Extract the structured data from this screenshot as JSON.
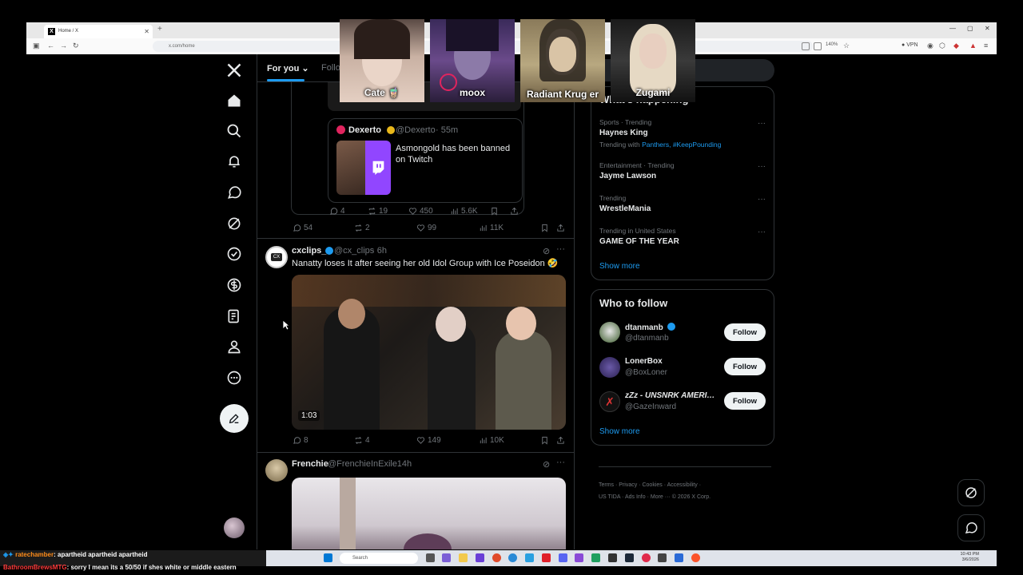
{
  "browser": {
    "tab_title": "Home / X",
    "url": "x.com/home",
    "zoom": "140%",
    "vpn_label": "VPN"
  },
  "overlay_cams": [
    {
      "name": "Cate 🧋"
    },
    {
      "name": "moox"
    },
    {
      "name": "Radiant Krug er"
    },
    {
      "name": "Zugami"
    }
  ],
  "timeline": {
    "tab_for_you": "For you",
    "tab_following": "Follo",
    "quote_tweet": {
      "author": "Dexerto",
      "handle": "@Dexerto",
      "time": "55m",
      "text": "Asmongold has been banned on Twitch",
      "replies": "4",
      "reposts": "19",
      "likes": "450",
      "views": "5.6K"
    },
    "tweet1_stats": {
      "replies": "54",
      "reposts": "2",
      "likes": "99",
      "views": "11K"
    },
    "tweet2": {
      "author": "cxclips_",
      "handle": "@cx_clips",
      "time": "6h",
      "text": "Nanatty loses It after seeing her old Idol Group with Ice Poseidon 🤣",
      "video_duration": "1:03",
      "replies": "8",
      "reposts": "4",
      "likes": "149",
      "views": "10K"
    },
    "tweet3": {
      "author": "Frenchie",
      "handle": "@FrenchieInExile",
      "time": "14h"
    }
  },
  "trends": {
    "header": "What's happening",
    "items": [
      {
        "meta": "Sports · Trending",
        "name": "Haynes King",
        "extra_prefix": "Trending with ",
        "extra_links": "Panthers, #KeepPounding"
      },
      {
        "meta": "Entertainment · Trending",
        "name": "Jayme Lawson"
      },
      {
        "meta": "Trending",
        "name": "WrestleMania"
      },
      {
        "meta": "Trending in United States",
        "name": "GAME OF THE YEAR"
      }
    ],
    "show_more": "Show more"
  },
  "who_to_follow": {
    "title": "Who to follow",
    "users": [
      {
        "name": "dtanmanb",
        "handle": "@dtanmanb",
        "button": "Follow"
      },
      {
        "name": "LonerBox",
        "handle": "@BoxLoner",
        "button": "Follow"
      },
      {
        "name": "zZz - UNSNRK AMERI…",
        "handle": "@GazeInward",
        "button": "Follow"
      }
    ],
    "show_more": "Show more"
  },
  "footer": {
    "row1": [
      "Terms",
      "Privacy",
      "Cookies",
      "Accessibility"
    ],
    "row2": [
      "US TIDA",
      "Ads Info",
      "More ···",
      "© 2026 X Corp."
    ]
  },
  "taskbar": {
    "search_placeholder": "Search",
    "time": "10:43 PM",
    "date": "3/6/2026"
  },
  "chat": [
    {
      "user": "ratechamber",
      "message": ": apartheid apartheid apartheid",
      "color": "#ff8c1a"
    },
    {
      "user": "BathroomBrewsMTG",
      "message": ": sorry I mean its a 50/50 if shes white or middle eastern",
      "color": "#ff3b3b"
    }
  ],
  "colors": {
    "accent": "#1d9bf0",
    "bg": "#000000",
    "border": "#2f3336",
    "muted": "#71767b"
  }
}
